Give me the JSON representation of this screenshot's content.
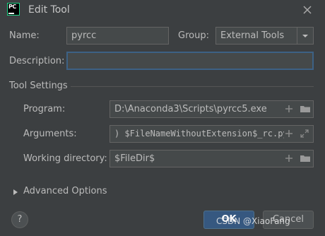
{
  "window": {
    "app_icon_text": "PC",
    "title": "Edit Tool"
  },
  "form": {
    "name_label": "Name:",
    "name_value": "pyrcc",
    "group_label": "Group:",
    "group_value": "External Tools",
    "description_label": "Description:",
    "description_value": ""
  },
  "tool_settings": {
    "section_title": "Tool Settings",
    "program_label": "Program:",
    "program_value": "D:\\Anaconda3\\Scripts\\pyrcc5.exe",
    "arguments_label": "Arguments:",
    "arguments_value": ") $FileNameWithoutExtension$_rc.py",
    "working_dir_label": "Working directory:",
    "working_dir_value": "$FileDir$"
  },
  "advanced": {
    "label": "Advanced Options"
  },
  "footer": {
    "help_label": "?",
    "ok_label": "OK",
    "cancel_label": "Cancel",
    "watermark": "CSDN @XiaoFang"
  },
  "colors": {
    "background": "#3c3f41",
    "field_bg": "#45494a",
    "focus_border": "#3d6185",
    "ok_button": "#365880",
    "text": "#bbbbbb"
  },
  "icons": [
    "pycharm-icon",
    "close-icon",
    "dropdown-arrow-icon",
    "plus-icon",
    "folder-icon",
    "expand-icon",
    "chevron-right-icon",
    "help-icon"
  ]
}
